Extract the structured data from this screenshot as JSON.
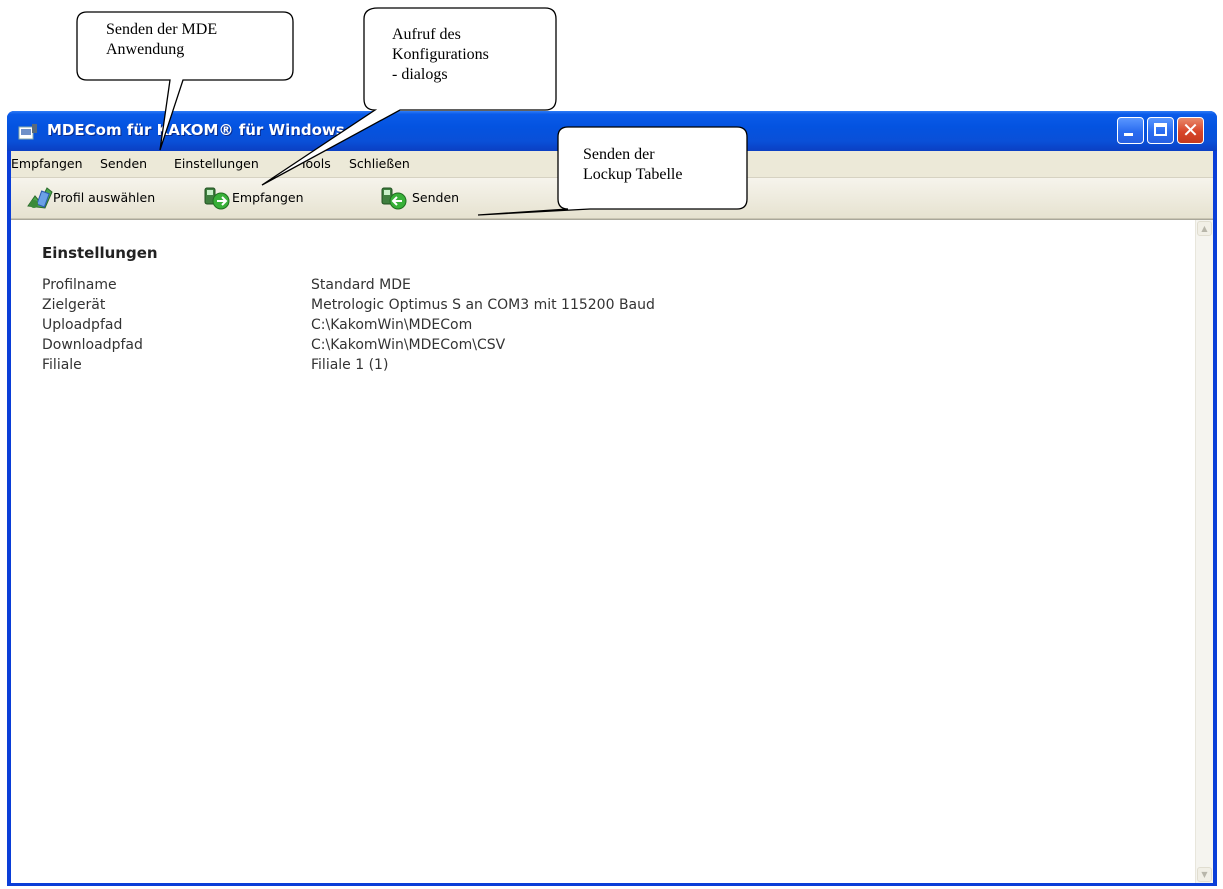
{
  "window": {
    "title": "MDECom für KAKOM® für Windows"
  },
  "menubar": {
    "items": [
      "Empfangen",
      "Senden",
      "Einstellungen",
      "Tools",
      "Schließen"
    ]
  },
  "toolbar": {
    "buttons": [
      "Profil auswählen",
      "Empfangen",
      "Senden"
    ]
  },
  "content": {
    "section_title": "Einstellungen",
    "rows": [
      {
        "label": "Profilname",
        "value": "Standard MDE"
      },
      {
        "label": "Zielgerät",
        "value": "Metrologic Optimus S an COM3 mit 115200 Baud"
      },
      {
        "label": "Uploadpfad",
        "value": "C:\\KakomWin\\MDECom"
      },
      {
        "label": "Downloadpfad",
        "value": "C:\\KakomWin\\MDECom\\CSV"
      },
      {
        "label": "Filiale",
        "value": "Filiale 1 (1)"
      }
    ]
  },
  "callouts": [
    {
      "lines": [
        "Senden der MDE",
        "Anwendung"
      ]
    },
    {
      "lines": [
        "Aufruf des",
        "Konfigurations",
        "- dialogs"
      ]
    },
    {
      "lines": [
        "Senden der",
        "Lockup Tabelle"
      ]
    }
  ],
  "colors": {
    "titlebar": "#0453e0",
    "window_frame": "#0a3ed8",
    "menubar": "#ece9d8",
    "close_button": "#d8452a"
  },
  "icons": [
    "app-icon",
    "profile-icon",
    "receive-icon",
    "send-icon",
    "minimize-icon",
    "maximize-icon",
    "close-icon"
  ]
}
